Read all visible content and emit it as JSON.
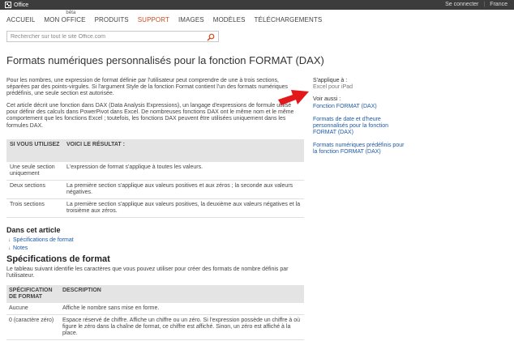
{
  "topbar": {
    "brand": "Office",
    "signin": "Se connecter",
    "region": "France"
  },
  "nav": {
    "items": [
      {
        "label": "ACCUEIL",
        "active": false
      },
      {
        "label": "MON OFFICE",
        "active": false
      },
      {
        "label": "PRODUITS",
        "active": false
      },
      {
        "label": "SUPPORT",
        "active": true
      },
      {
        "label": "IMAGES",
        "active": false
      },
      {
        "label": "MODÈLES",
        "active": false
      },
      {
        "label": "TÉLÉCHARGEMENTS",
        "active": false
      }
    ],
    "beta": "bêta"
  },
  "search": {
    "placeholder": "Rechercher sur tout le site Office.com"
  },
  "page": {
    "title": "Formats numériques personnalisés pour la fonction FORMAT (DAX)",
    "intro": "Pour les nombres, une expression de format définie par l'utilisateur peut comprendre de une à trois sections, séparées par des points-virgules. Si l'argument Style de la fonction Format contient l'un des formats numériques prédéfinis, une seule section est autorisée.",
    "intro2": "Cet article décrit une fonction dans DAX (Data Analysis Expressions), un langage d'expressions de formule utilisé pour définir des calculs dans PowerPivot dans Excel. De nombreuses fonctions DAX ont le même nom et le même comportement que les fonctions Excel ; toutefois, les fonctions DAX peuvent être utilisées uniquement dans les formules DAX."
  },
  "table1": {
    "headers": [
      "SI VOUS UTILISEZ",
      "VOICI LE RÉSULTAT :"
    ],
    "rows": [
      [
        "Une seule section uniquement",
        "L'expression de format s'applique à toutes les valeurs."
      ],
      [
        "Deux sections",
        "La première section s'applique aux valeurs positives et aux zéros ; la seconde aux valeurs négatives."
      ],
      [
        "Trois sections",
        "La première section s'applique aux valeurs positives, la deuxième aux valeurs négatives et la troisième aux zéros."
      ]
    ]
  },
  "in_article": {
    "heading": "Dans cet article",
    "links": [
      "Spécifications de format",
      "Notes"
    ]
  },
  "spec": {
    "title": "Spécifications de format",
    "intro": "Le tableau suivant identifie les caractères que vous pouvez utiliser pour créer des formats de nombre définis par l'utilisateur."
  },
  "table2": {
    "headers": [
      "SPÉCIFICATION DE FORMAT",
      "DESCRIPTION"
    ],
    "rows": [
      [
        "Aucune",
        "Affiche le nombre sans mise en forme."
      ],
      [
        "0 (caractère zéro)",
        "Espace réservé de chiffre. Affiche un chiffre ou un zéro. Si l'expression possède un chiffre à où figure le zéro dans la chaîne de format, ce chiffre est affiché. Sinon, un zéro est affiché à la place."
      ]
    ]
  },
  "sidebar": {
    "applies_label": "S'applique à :",
    "applies_value": "Excel pour iPad",
    "see_also_label": "Voir aussi :",
    "links": [
      "Fonction FORMAT (DAX)",
      "Formats de date et d'heure personnalisés pour la fonction FORMAT (DAX)",
      "Formats numériques prédéfinis pour la fonction FORMAT (DAX)"
    ]
  },
  "colors": {
    "accent": "#d04a1c",
    "link": "#1e5aa8",
    "arrow": "#e3181b",
    "topbar": "#3c3c3c"
  }
}
